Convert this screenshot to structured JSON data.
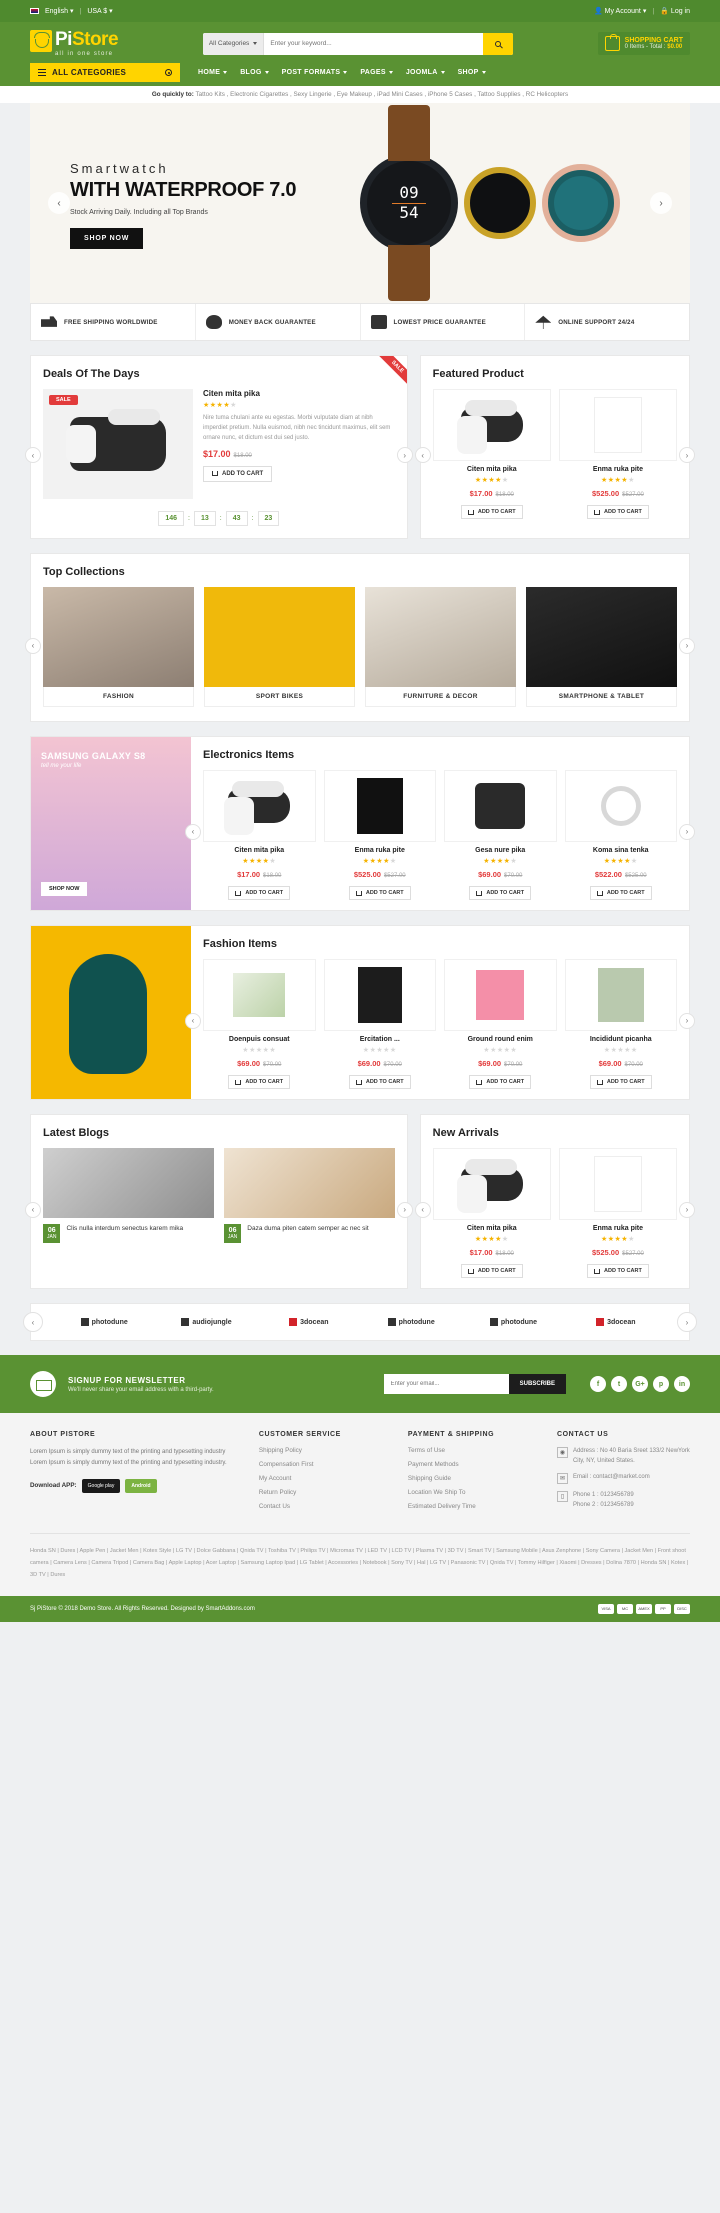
{
  "topbar": {
    "language": "English",
    "currency": "USA $",
    "account": "My Account",
    "login": "Log in"
  },
  "header": {
    "logo_main": "Pi",
    "logo_accent": "Store",
    "logo_tagline": "all in one store",
    "search_category": "All Categories",
    "search_placeholder": "Enter your keyword...",
    "search_icon": "search-icon",
    "cart_title": "SHOPPING CART",
    "cart_items": "0 Items - Total :",
    "cart_total": "$0.00"
  },
  "nav": {
    "all_categories": "ALL CATEGORIES",
    "items": [
      "HOME",
      "BLOG",
      "POST FORMATS",
      "PAGES",
      "JOOMLA",
      "SHOP"
    ]
  },
  "quicklinks": {
    "label": "Go quickly to:",
    "text": "Tattoo Kits , Electronic Cigarettes , Sexy Lingerie , Eye Makeup , iPad Mini Cases , iPhone 5 Cases , Tattoo Supplies , RC Helicopters"
  },
  "hero": {
    "subtitle": "Smartwatch",
    "title": "WITH WATERPROOF 7.0",
    "desc": "Stock Arriving Daily. Including all Top Brands",
    "button": "SHOP NOW",
    "watch_hours": "09",
    "watch_minutes": "54",
    "prev_icon": "chevron-left-icon",
    "next_icon": "chevron-right-icon"
  },
  "services": [
    {
      "icon": "truck-icon",
      "label": "FREE SHIPPING WORLDWIDE"
    },
    {
      "icon": "money-back-icon",
      "label": "MONEY BACK GUARANTEE"
    },
    {
      "icon": "calendar-icon",
      "label": "LOWEST PRICE GUARANTEE"
    },
    {
      "icon": "umbrella-icon",
      "label": "ONLINE SUPPORT 24/24"
    }
  ],
  "deals": {
    "title": "Deals Of The Days",
    "ribbon": "SALE",
    "badge": "SALE",
    "product": {
      "name": "Citen mita pika",
      "rating": 4,
      "desc": "Nire tuma chulani ante eu egestas. Morbi vulputate diam at nibh imperdiet pretium. Nulla euismod, nibh nec tincidunt maximus, elit sem ornare nunc, et dictum est dui sed justo.",
      "price": "$17.00",
      "old_price": "$18.00",
      "add_to_cart": "ADD TO CART"
    },
    "timer": {
      "days": "146",
      "hours": "13",
      "minutes": "43",
      "seconds": "23"
    }
  },
  "featured": {
    "title": "Featured Product",
    "products": [
      {
        "name": "Citen mita pika",
        "rating": 4,
        "price": "$17.00",
        "old_price": "$18.00",
        "add_to_cart": "ADD TO CART"
      },
      {
        "name": "Enma ruka pite",
        "rating": 4,
        "price": "$525.00",
        "old_price": "$527.00",
        "add_to_cart": "ADD TO CART"
      }
    ]
  },
  "collections": {
    "title": "Top Collections",
    "items": [
      {
        "caption": "FASHION"
      },
      {
        "caption": "SPORT BIKES"
      },
      {
        "caption": "FURNITURE & DECOR"
      },
      {
        "caption": "SMARTPHONE & TABLET"
      }
    ]
  },
  "electronics": {
    "title": "Electronics Items",
    "promo_title": "SAMSUNG GALAXY S8",
    "promo_sub": "tell me your life",
    "promo_btn": "SHOP NOW",
    "products": [
      {
        "name": "Citen mita pika",
        "rating": 4,
        "price": "$17.00",
        "old_price": "$18.00",
        "add_to_cart": "ADD TO CART"
      },
      {
        "name": "Enma ruka pite",
        "rating": 4,
        "price": "$525.00",
        "old_price": "$527.00",
        "add_to_cart": "ADD TO CART"
      },
      {
        "name": "Gesa nure pika",
        "rating": 4,
        "price": "$69.00",
        "old_price": "$70.00",
        "add_to_cart": "ADD TO CART"
      },
      {
        "name": "Koma sina tenka",
        "rating": 4,
        "price": "$522.00",
        "old_price": "$525.00",
        "add_to_cart": "ADD TO CART"
      }
    ]
  },
  "fashion": {
    "title": "Fashion Items",
    "products": [
      {
        "name": "Doenpuis consuat",
        "rating": 0,
        "price": "$69.00",
        "old_price": "$70.00",
        "add_to_cart": "ADD TO CART"
      },
      {
        "name": "Ercitation ...",
        "rating": 0,
        "price": "$69.00",
        "old_price": "$70.00",
        "add_to_cart": "ADD TO CART"
      },
      {
        "name": "Ground round enim",
        "rating": 0,
        "price": "$69.00",
        "old_price": "$70.00",
        "add_to_cart": "ADD TO CART"
      },
      {
        "name": "Incididunt picanha",
        "rating": 0,
        "price": "$69.00",
        "old_price": "$70.00",
        "add_to_cart": "ADD TO CART"
      }
    ]
  },
  "blogs": {
    "title": "Latest Blogs",
    "posts": [
      {
        "day": "06",
        "month": "JAN",
        "title": "Clis nulla interdum senectus karem mika"
      },
      {
        "day": "06",
        "month": "JAN",
        "title": "Daza duma piten catem semper ac nec sit"
      }
    ]
  },
  "arrivals": {
    "title": "New Arrivals",
    "products": [
      {
        "name": "Citen mita pika",
        "rating": 4,
        "price": "$17.00",
        "old_price": "$18.00",
        "add_to_cart": "ADD TO CART"
      },
      {
        "name": "Enma ruka pite",
        "rating": 4,
        "price": "$525.00",
        "old_price": "$527.00",
        "add_to_cart": "ADD TO CART"
      }
    ]
  },
  "brands": [
    {
      "name": "photodune"
    },
    {
      "name": "audiojungle"
    },
    {
      "name": "3docean"
    },
    {
      "name": "photodune"
    },
    {
      "name": "photodune"
    },
    {
      "name": "3docean"
    }
  ],
  "newsletter": {
    "title": "SIGNUP FOR NEWSLETTER",
    "subtitle": "We'll never share your email address with a third-party.",
    "placeholder": "Enter your email...",
    "button": "SUBSCRIBE",
    "socials": [
      "f",
      "t",
      "G+",
      "p",
      "in"
    ]
  },
  "footer": {
    "about": {
      "heading": "ABOUT PISTORE",
      "text": "Lorem Ipsum is simply dummy text of the printing and typesetting industry Lorem Ipsum is simply dummy text of the printing and typesetting industry.",
      "download_label": "Download APP:",
      "app1": "Google play",
      "app2": "Android"
    },
    "customer_service": {
      "heading": "CUSTOMER SERVICE",
      "links": [
        "Shipping Policy",
        "Compensation First",
        "My Account",
        "Return Policy",
        "Contact Us"
      ]
    },
    "payment": {
      "heading": "PAYMENT & SHIPPING",
      "links": [
        "Terms of Use",
        "Payment Methods",
        "Shipping Guide",
        "Location We Ship To",
        "Estimated Delivery Time"
      ]
    },
    "contact": {
      "heading": "CONTACT US",
      "items": [
        {
          "icon": "location-icon",
          "text": "Address : No 40 Baria Sreet 133/2 NewYork City, NY, United States."
        },
        {
          "icon": "email-icon",
          "text": "Email : contact@market.com"
        },
        {
          "icon": "phone-icon",
          "text": "Phone 1 : 0123456789\nPhone 2 : 0123456789"
        }
      ]
    },
    "tags": "Honda SN | Dures | Apple Pen | Jacket Men | Kotex Style | LG TV | Dolce Gabbana | Qnida TV | Toshiba TV | Philips TV | Micromax TV | LED TV | LCD TV | Plasma TV | 3D TV | Smart TV | Samsung Mobile | Asus Zenphone | Sony Camera | Jacket Men | Front shoot camera | Camera Lens | Camera Tripod | Camera Bag | Apple Laptop | Acer Laptop | Samsung Laptop Ipad | LG Tablet | Accessories | Notebook | Sony TV | Hal | LG TV | Panasonic TV | Qnida TV | Tommy Hilfiger | Xiaomi | Dresses | Dolina 7870 | Honda SN | Kotex | 3D TV | Dures",
    "copyright": "Sj PiStore © 2018 Demo Store. All Rights Reserved. Designed by SmartAddons.com",
    "payments": [
      "VISA",
      "MC",
      "AMEX",
      "PP",
      "DISC"
    ]
  }
}
